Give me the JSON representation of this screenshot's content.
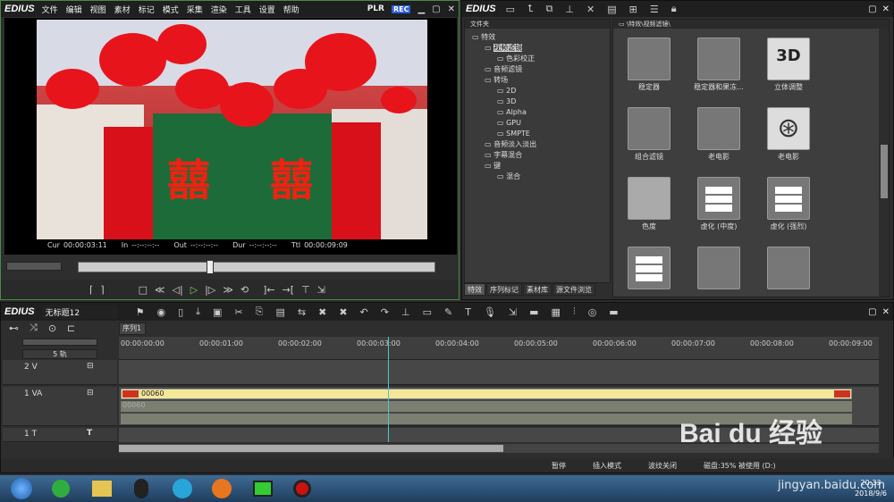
{
  "player": {
    "logo": "EDIUS",
    "menu": [
      "文件",
      "编辑",
      "视图",
      "素材",
      "标记",
      "模式",
      "采集",
      "渲染",
      "工具",
      "设置",
      "帮助"
    ],
    "plr": "PLR",
    "rec": "REC",
    "timecodes": {
      "cur_label": "Cur",
      "cur": "00:00:03:11",
      "in_label": "In",
      "in": "--:--:--:--",
      "out_label": "Out",
      "out": "--:--:--:--",
      "dur_label": "Dur",
      "dur": "--:--:--:--",
      "ttl_label": "Ttl",
      "ttl": "00:00:09:09"
    },
    "scrub_position": 0.37
  },
  "browser": {
    "logo": "EDIUS",
    "tree_header": "文件夹",
    "path": "\\特效\\视频滤镜\\",
    "tree": [
      {
        "label": "特效",
        "indent": 0
      },
      {
        "label": "视频滤镜",
        "indent": 1,
        "selected": true
      },
      {
        "label": "色彩校正",
        "indent": 2
      },
      {
        "label": "音频滤镜",
        "indent": 1
      },
      {
        "label": "转场",
        "indent": 1
      },
      {
        "label": "2D",
        "indent": 2
      },
      {
        "label": "3D",
        "indent": 2
      },
      {
        "label": "Alpha",
        "indent": 2
      },
      {
        "label": "GPU",
        "indent": 2
      },
      {
        "label": "SMPTE",
        "indent": 2
      },
      {
        "label": "音频淡入淡出",
        "indent": 1
      },
      {
        "label": "字幕混合",
        "indent": 1
      },
      {
        "label": "键",
        "indent": 1
      },
      {
        "label": "混合",
        "indent": 2
      }
    ],
    "tabs": [
      "特效",
      "序列标记",
      "素材库",
      "源文件浏览"
    ],
    "effects": [
      {
        "label": "稳定器",
        "icon": "stabilizer-icon"
      },
      {
        "label": "稳定器和果冻...",
        "icon": "stabilizer-rolling-icon"
      },
      {
        "label": "立体调整",
        "icon": "3d-icon",
        "glyph": "3D"
      },
      {
        "label": "组合滤镜",
        "icon": "layers-icon"
      },
      {
        "label": "老电影",
        "icon": "old-film-icon"
      },
      {
        "label": "老电影",
        "icon": "film-reel-icon"
      },
      {
        "label": "色度",
        "icon": "chroma-icon"
      },
      {
        "label": "虚化 (中度)",
        "icon": "blur-medium-icon"
      },
      {
        "label": "虚化 (强烈)",
        "icon": "blur-strong-icon"
      },
      {
        "label": "",
        "icon": "grid-icon"
      },
      {
        "label": "",
        "icon": "noise-icon"
      },
      {
        "label": "",
        "icon": "axis-icon"
      }
    ]
  },
  "timeline": {
    "logo": "EDIUS",
    "project": "无标题12",
    "sequence_tab": "序列1",
    "track_count": "5 轨",
    "ruler": [
      "00:00:00:00",
      "00:00:01:00",
      "00:00:02:00",
      "00:00:03:00",
      "00:00:04:00",
      "00:00:05:00",
      "00:00:06:00",
      "00:00:07:00",
      "00:00:08:00",
      "00:00:09:00"
    ],
    "tracks": [
      {
        "label": "2 V",
        "type": "V"
      },
      {
        "label": "1 VA",
        "type": "VA"
      },
      {
        "label": "1 T",
        "type": "T"
      }
    ],
    "clip_label": "00060",
    "audio_clip_label": "00060",
    "status": [
      "暂停",
      "插入模式",
      "波纹关闭",
      "磁盘:35% 被使用 (D:)"
    ]
  },
  "taskbar": {
    "time": "20:33",
    "date": "2018/9/6"
  },
  "watermark": {
    "brand": "Bai du 经验",
    "url": "jingyan.baidu.com"
  },
  "colors": {
    "accent_blue": "#3a6cc8",
    "clip_yellow": "#f3e79a",
    "playhead": "#4ac7c7",
    "panel_bg": "#333333"
  }
}
